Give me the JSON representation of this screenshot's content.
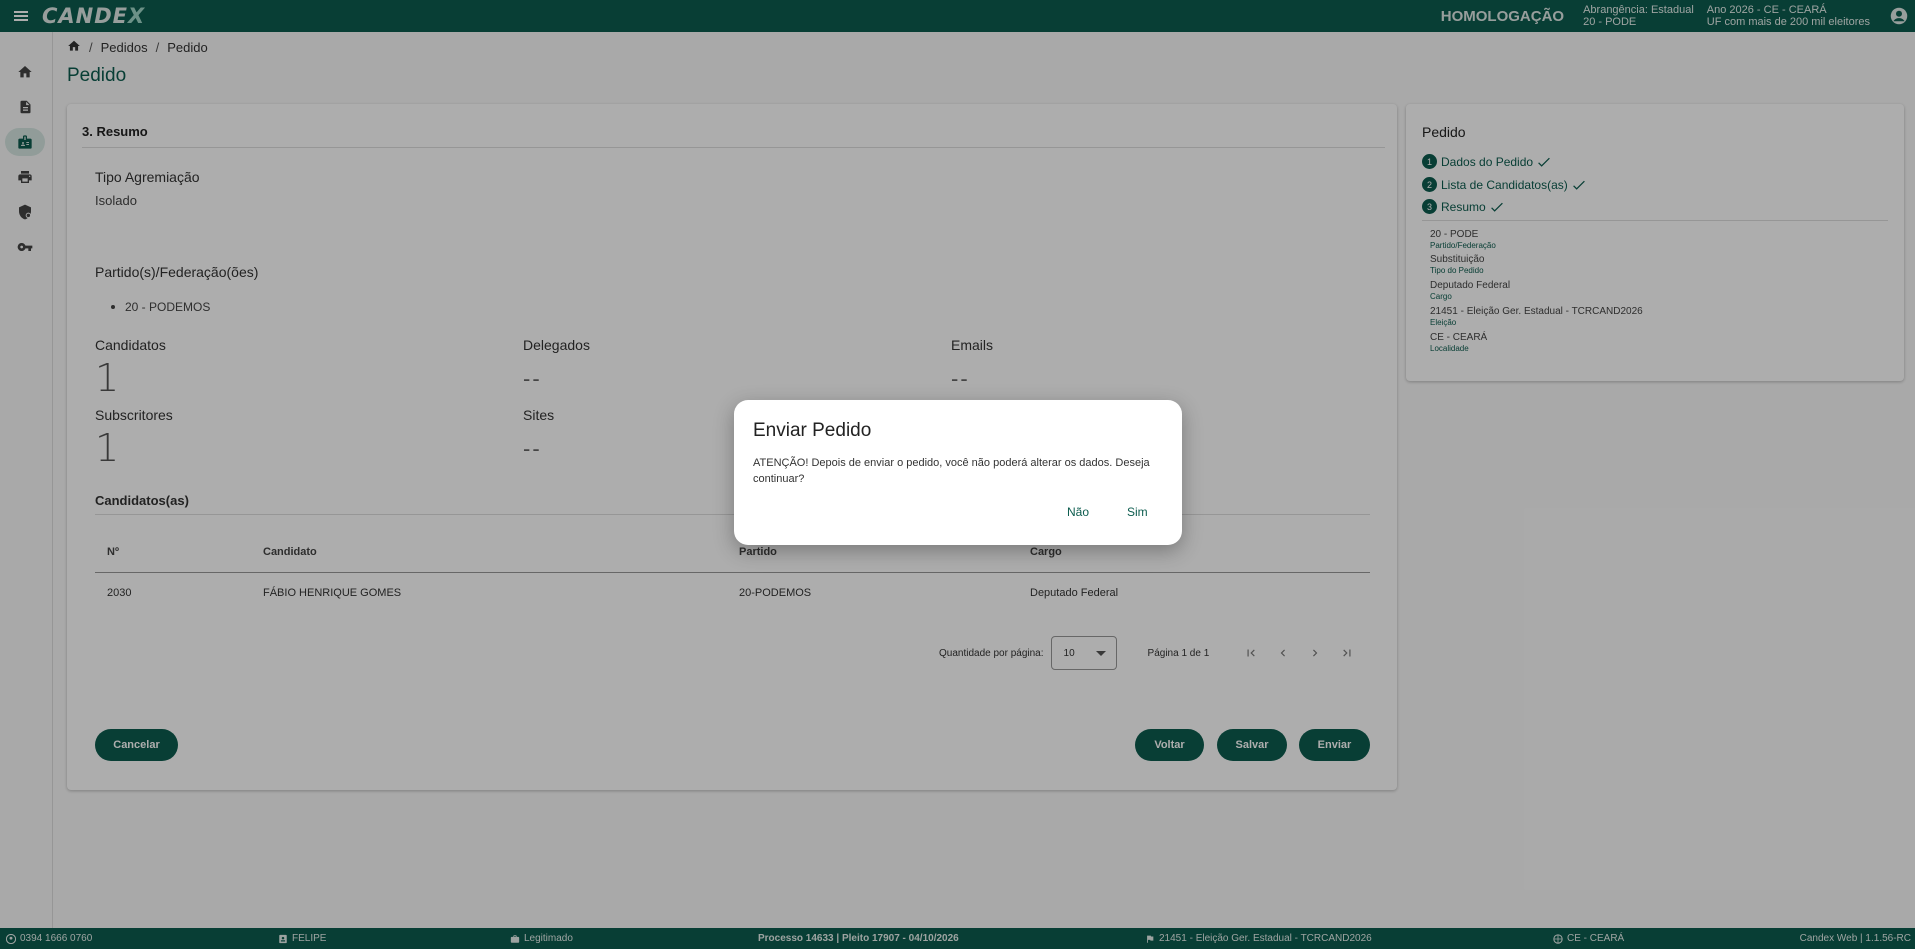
{
  "header": {
    "logo": "CANDEX",
    "environment": "HOMOLOGAÇÃO",
    "abrangencia_line1": "Abrangência: Estadual",
    "abrangencia_line2": "20 - PODE",
    "ano_line1": "Ano 2026 - CE - CEARÁ",
    "ano_line2": "UF com mais de 200 mil eleitores"
  },
  "breadcrumb": {
    "items": [
      "Pedidos",
      "Pedido"
    ]
  },
  "page_title": "Pedido",
  "resumo": {
    "section_title": "3. Resumo",
    "tipo_label": "Tipo Agremiação",
    "tipo_value": "Isolado",
    "partidos_label": "Partido(s)/Federação(ões)",
    "partidos": [
      "20 - PODEMOS"
    ],
    "stats": {
      "candidatos_label": "Candidatos",
      "candidatos_value": "1",
      "delegados_label": "Delegados",
      "delegados_value": "--",
      "emails_label": "Emails",
      "emails_value": "--",
      "subscritores_label": "Subscritores",
      "subscritores_value": "1",
      "sites_label": "Sites",
      "sites_value": "--"
    },
    "candidatos_section": "Candidatos(as)"
  },
  "table": {
    "columns": [
      "Nº",
      "Candidato",
      "Partido",
      "Cargo"
    ],
    "rows": [
      [
        "2030",
        "FÁBIO HENRIQUE GOMES",
        "20-PODEMOS",
        "Deputado Federal"
      ]
    ]
  },
  "paginator": {
    "per_page_label": "Quantidade por página:",
    "per_page_value": "10",
    "range": "Página 1 de 1"
  },
  "buttons": {
    "cancel": "Cancelar",
    "back": "Voltar",
    "save": "Salvar",
    "send": "Enviar"
  },
  "side_panel": {
    "title": "Pedido",
    "steps": [
      {
        "num": "1",
        "label": "Dados do Pedido"
      },
      {
        "num": "2",
        "label": "Lista de Candidatos(as)"
      },
      {
        "num": "3",
        "label": "Resumo"
      }
    ],
    "summary": [
      {
        "value": "20 - PODE",
        "label": "Partido/Federação"
      },
      {
        "value": "Substituição",
        "label": "Tipo do Pedido"
      },
      {
        "value": "Deputado Federal",
        "label": "Cargo"
      },
      {
        "value": "21451 - Eleição Ger. Estadual - TCRCAND2026",
        "label": "Eleição"
      },
      {
        "value": "CE - CEARÁ",
        "label": "Localidade"
      }
    ]
  },
  "footer": {
    "phone": "0394 1666 0760",
    "user": "FELIPE",
    "role": "Legitimado",
    "process": "Processo 14633 | Pleito 17907 - 04/10/2026",
    "election": "21451 - Eleição Ger. Estadual - TCRCAND2026",
    "location": "CE - CEARÁ",
    "version": "Candex Web | 1.1.56-RC"
  },
  "dialog": {
    "title": "Enviar Pedido",
    "message": "ATENÇÃO! Depois de enviar o pedido, você não poderá alterar os dados. Deseja continuar?",
    "no": "Não",
    "yes": "Sim"
  },
  "colors": {
    "primary": "#0c5c4e",
    "overlay": "rgba(0,0,0,0.32)"
  }
}
